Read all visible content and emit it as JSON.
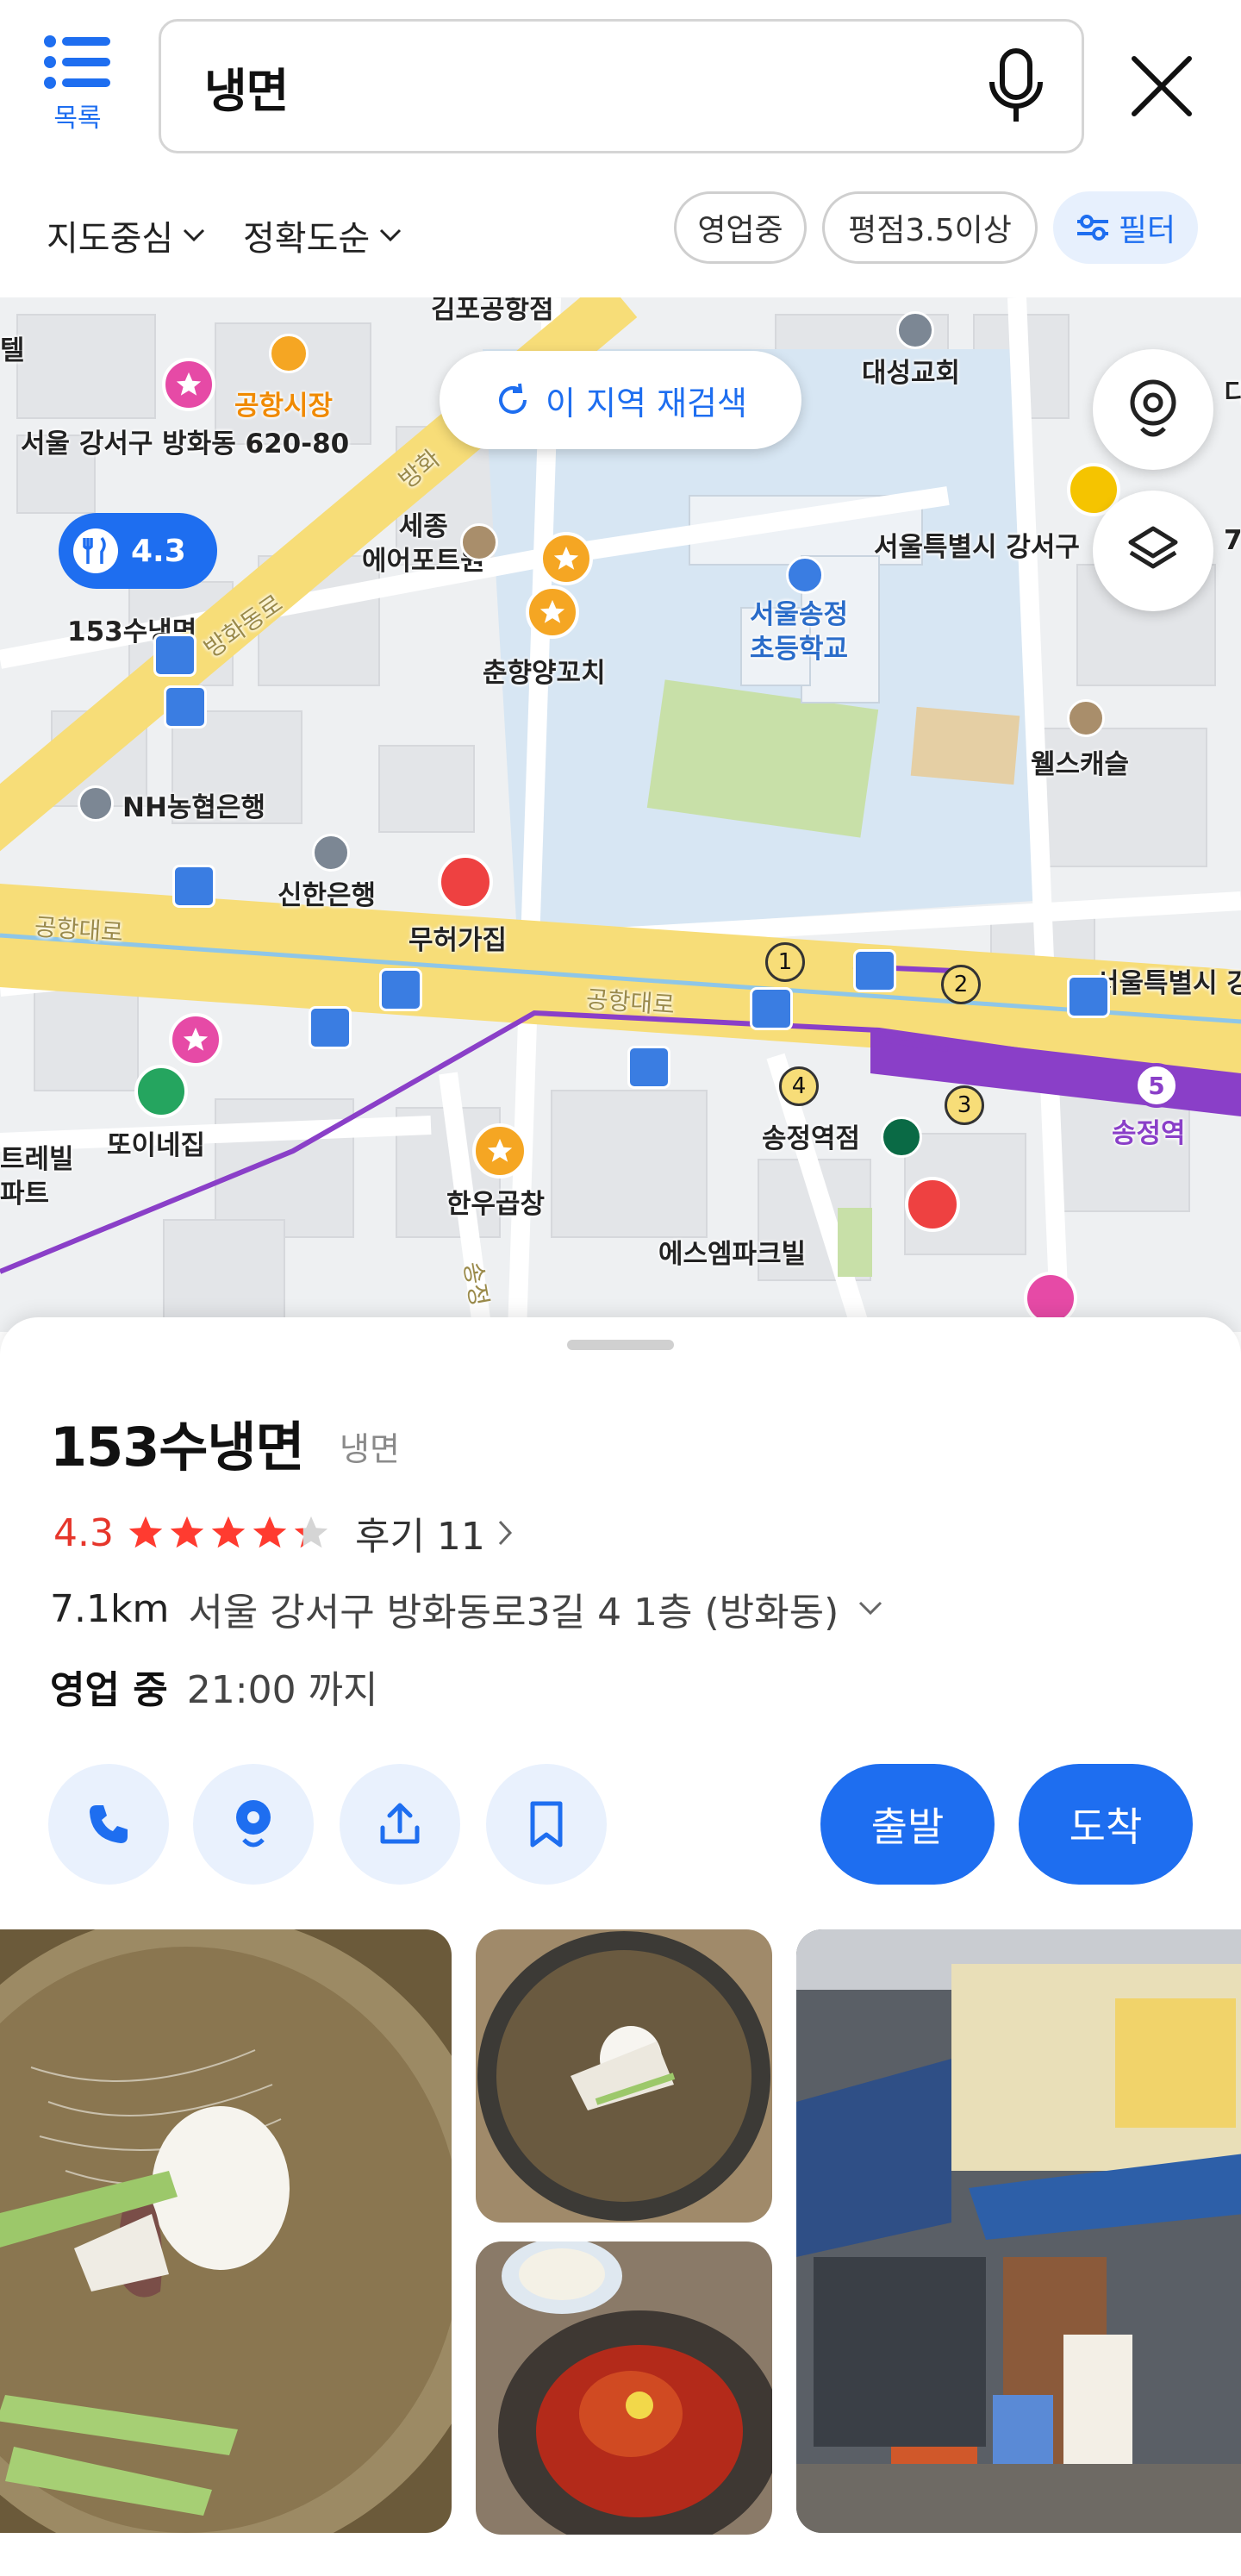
{
  "topbar": {
    "menu_label": "목록",
    "search_query": "냉면"
  },
  "sort": {
    "map_center": "지도중심",
    "accuracy": "정확도순"
  },
  "chips": {
    "open_now": "영업중",
    "rating": "평점3.5이상",
    "filter": "필터"
  },
  "map": {
    "rescan_label": "이 지역 재검색",
    "pin_rating": "4.3",
    "labels": {
      "airport_market": "공항시장",
      "address_620": "서울 강서구 방화동 620-80",
      "place_153": "153수냉면",
      "bangwha_road": "방화동로",
      "bangwha": "방화",
      "sejong_airport": "세종\n에어포트원",
      "chunhyang": "춘향양꼬치",
      "songjeong_school": "서울송정\n초등학교",
      "daesung_church": "대성교회",
      "seoul_gangseo": "서울특별시 강서구",
      "wells_castle": "웰스캐슬",
      "nh_bank": "NH농협은행",
      "shinhan_bank": "신한은행",
      "muheo": "무허가집",
      "airport_road_left": "공항대로",
      "airport_road_mid": "공항대로",
      "seoul_right": "서울특별시 강",
      "ttoine": "또이네집",
      "hanwoo": "한우곱창",
      "songjeong_station_store": "송정역점",
      "songjeong_station": "송정역",
      "sm_park": "에스엠파크빌",
      "terrace": "트레빌\n파트",
      "gimpo_top": "김포공항점",
      "songjeong_vertical": "송정",
      "cut_left": "텔",
      "cut_right_di": "디",
      "cut_right_7": "7",
      "exit1": "1",
      "exit2": "2",
      "exit3": "3",
      "exit4": "4",
      "line5": "5"
    }
  },
  "place": {
    "name": "153수냉면",
    "category": "냉면",
    "rating": "4.3",
    "stars": 4.3,
    "reviews": "후기 11",
    "distance": "7.1km",
    "address": "서울 강서구 방화동로3길 4 1층 (방화동)",
    "status": "영업 중",
    "hours": "21:00 까지",
    "depart": "출발",
    "arrive": "도착"
  },
  "colors": {
    "accent": "#1e6ef0",
    "rating_red": "#e6362b",
    "star": "#ff3b30",
    "metro_line5": "#8a3fc8",
    "road_yellow": "#f7dd78"
  }
}
